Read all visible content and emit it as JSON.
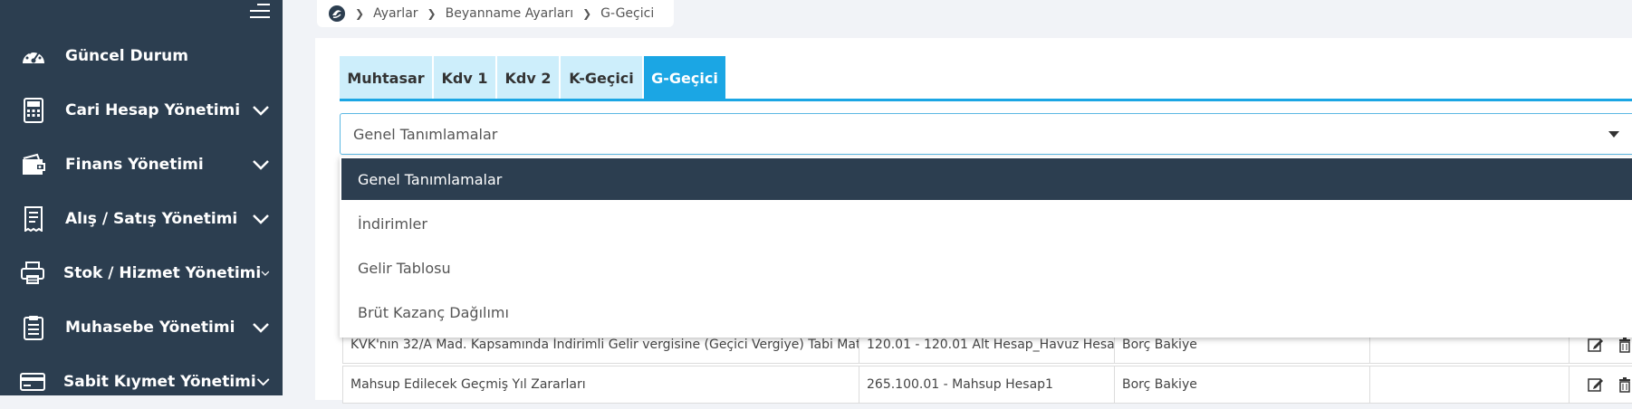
{
  "sidebar": {
    "items": [
      {
        "label": "Güncel Durum",
        "icon": "dashboard-gauge-icon",
        "has_submenu": false
      },
      {
        "label": "Cari Hesap Yönetimi",
        "icon": "calculator-icon",
        "has_submenu": true
      },
      {
        "label": "Finans Yönetimi",
        "icon": "wallet-icon",
        "has_submenu": true
      },
      {
        "label": "Alış / Satış Yönetimi",
        "icon": "receipt-icon",
        "has_submenu": true
      },
      {
        "label": "Stok / Hizmet Yönetimi",
        "icon": "printer-icon",
        "has_submenu": true
      },
      {
        "label": "Muhasebe Yönetimi",
        "icon": "clipboard-icon",
        "has_submenu": true
      },
      {
        "label": "Sabit Kıymet Yönetimi",
        "icon": "credit-card-icon",
        "has_submenu": true
      }
    ]
  },
  "breadcrumb": {
    "items": [
      "Ayarlar",
      "Beyanname Ayarları",
      "G-Geçici"
    ]
  },
  "tabs": [
    {
      "label": "Muhtasar",
      "active": false
    },
    {
      "label": "Kdv 1",
      "active": false
    },
    {
      "label": "Kdv 2",
      "active": false
    },
    {
      "label": "K-Geçici",
      "active": false
    },
    {
      "label": "G-Geçici",
      "active": true
    }
  ],
  "section_select": {
    "value": "Genel Tanımlamalar",
    "options": [
      "Genel Tanımlamalar",
      "İndirimler",
      "Gelir Tablosu",
      "Brüt Kazanç Dağılımı"
    ]
  },
  "table": {
    "rows": [
      {
        "description": "KVK'nın 32/A Mad. Kapsamında İndirimli Gelir vergisine (Geçici Vergiye) Tabi Matr...",
        "account": "120.01 - 120.01 Alt Hesap_Havuz Hesa...",
        "balance_type": "Borç Bakiye",
        "extra": ""
      },
      {
        "description": "Mahsup Edilecek Geçmiş Yıl Zararları",
        "account": "265.100.01 - Mahsup Hesap1",
        "balance_type": "Borç Bakiye",
        "extra": ""
      }
    ]
  },
  "colors": {
    "sidebar_bg": "#2c3e50",
    "accent": "#1ba6e4",
    "tab_inactive": "#cdeefb"
  }
}
